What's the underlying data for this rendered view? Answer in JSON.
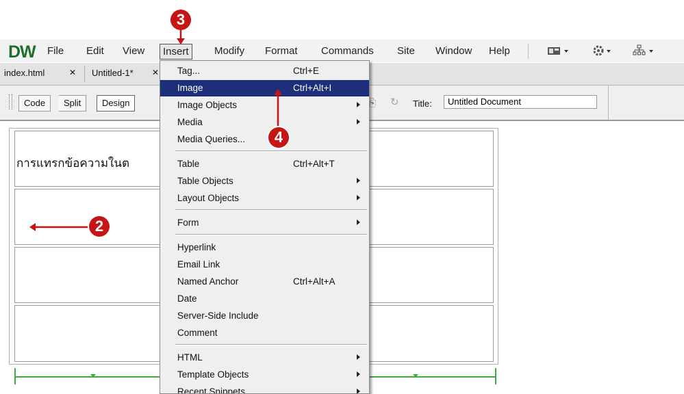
{
  "menubar": {
    "logo": "DW",
    "items": [
      "File",
      "Edit",
      "View",
      "Insert",
      "Modify",
      "Format",
      "Commands",
      "Site",
      "Window",
      "Help"
    ]
  },
  "tabs": [
    {
      "label": "index.html"
    },
    {
      "label": "Untitled-1*"
    }
  ],
  "toolbar": {
    "views": [
      "Code",
      "Split",
      "Design"
    ],
    "title_label": "Title:",
    "title_value": "Untitled Document"
  },
  "document": {
    "thai_text": "การแทรกข้อความในต"
  },
  "insert_menu": {
    "sections": [
      [
        {
          "label": "Tag...",
          "shortcut": "Ctrl+E",
          "submenu": false,
          "highlighted": false
        },
        {
          "label": "Image",
          "shortcut": "Ctrl+Alt+I",
          "submenu": false,
          "highlighted": true
        },
        {
          "label": "Image Objects",
          "shortcut": "",
          "submenu": true,
          "highlighted": false
        },
        {
          "label": "Media",
          "shortcut": "",
          "submenu": true,
          "highlighted": false
        },
        {
          "label": "Media Queries...",
          "shortcut": "",
          "submenu": false,
          "highlighted": false
        }
      ],
      [
        {
          "label": "Table",
          "shortcut": "Ctrl+Alt+T",
          "submenu": false,
          "highlighted": false
        },
        {
          "label": "Table Objects",
          "shortcut": "",
          "submenu": true,
          "highlighted": false
        },
        {
          "label": "Layout Objects",
          "shortcut": "",
          "submenu": true,
          "highlighted": false
        }
      ],
      [
        {
          "label": "Form",
          "shortcut": "",
          "submenu": true,
          "highlighted": false
        }
      ],
      [
        {
          "label": "Hyperlink",
          "shortcut": "",
          "submenu": false,
          "highlighted": false
        },
        {
          "label": "Email Link",
          "shortcut": "",
          "submenu": false,
          "highlighted": false
        },
        {
          "label": "Named Anchor",
          "shortcut": "Ctrl+Alt+A",
          "submenu": false,
          "highlighted": false
        },
        {
          "label": "Date",
          "shortcut": "",
          "submenu": false,
          "highlighted": false
        },
        {
          "label": "Server-Side Include",
          "shortcut": "",
          "submenu": false,
          "highlighted": false
        },
        {
          "label": "Comment",
          "shortcut": "",
          "submenu": false,
          "highlighted": false
        }
      ],
      [
        {
          "label": "HTML",
          "shortcut": "",
          "submenu": true,
          "highlighted": false
        },
        {
          "label": "Template Objects",
          "shortcut": "",
          "submenu": true,
          "highlighted": false
        },
        {
          "label": "Recent Snippets",
          "shortcut": "",
          "submenu": true,
          "highlighted": false
        }
      ]
    ]
  },
  "annotations": {
    "step_insert": "3",
    "step_image": "4",
    "step_cell": "2",
    "color": "#c71414"
  },
  "colors": {
    "logo": "#1f6f2c",
    "menu_highlight": "#1d2e7a",
    "width_guide": "#3fae3f"
  }
}
